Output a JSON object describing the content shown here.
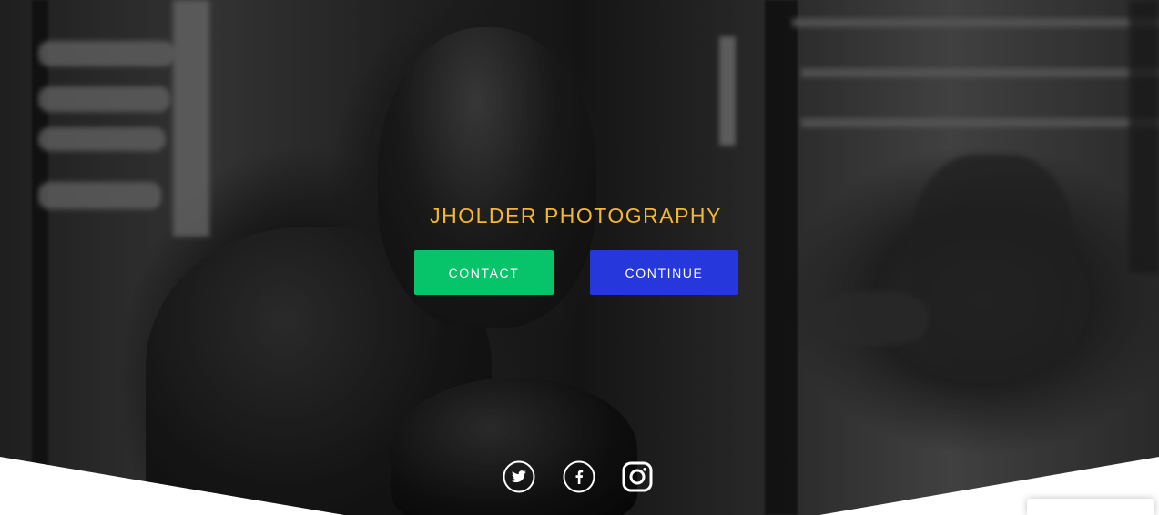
{
  "site": {
    "title": "JHOLDER PHOTOGRAPHY"
  },
  "buttons": {
    "contact_label": "CONTACT",
    "continue_label": "CONTINUE"
  },
  "social": [
    {
      "name": "twitter-icon"
    },
    {
      "name": "facebook-icon"
    },
    {
      "name": "instagram-icon"
    }
  ],
  "colors": {
    "title": "#f4b731",
    "contact": "#07c46b",
    "continue": "#2638dc"
  }
}
